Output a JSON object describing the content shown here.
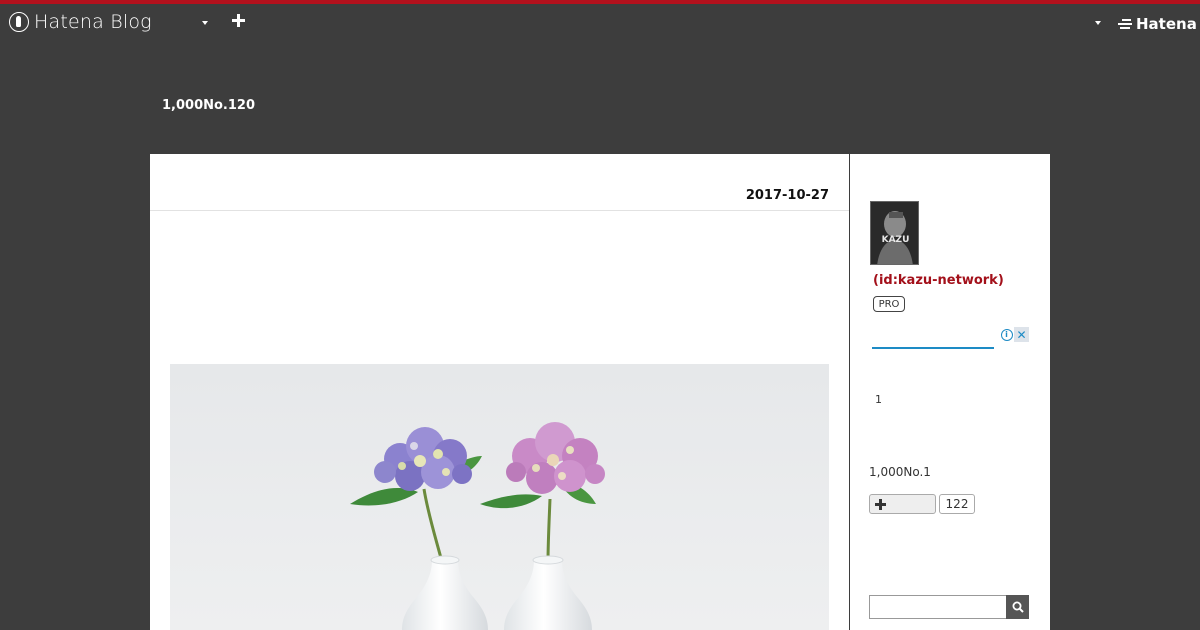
{
  "header": {
    "logo_text": "Hatena Blog",
    "hatena_text": "Hatena",
    "accent_color": "#b3111d"
  },
  "blog": {
    "title": "1,000No.120"
  },
  "entry": {
    "date": "2017-10-27",
    "image_subject": "two hydrangea sprigs in white sake flasks"
  },
  "sidebar": {
    "user_id": "(id:kazu-network)",
    "avatar_text": "KAZU",
    "pro_label": "PRO",
    "item_number": "1",
    "subscribe_title": "1,000No.1",
    "subscribe_count": "122",
    "search_placeholder": ""
  },
  "icons": [
    "hatena-blog-logo-icon",
    "chevron-down-icon",
    "plus-icon",
    "hatena-logo-icon",
    "ad-info-icon",
    "close-icon",
    "search-icon"
  ]
}
